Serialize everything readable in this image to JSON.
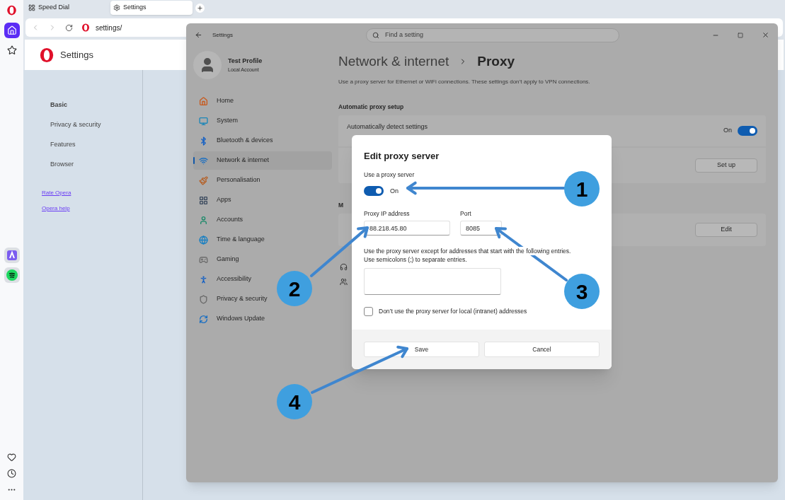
{
  "browser_sidebar": {
    "top": [
      {
        "kind": "home",
        "selected": true
      },
      {
        "kind": "star",
        "selected": false
      }
    ],
    "apps": [
      {
        "kind": "aria",
        "selected": false
      },
      {
        "kind": "spotify",
        "selected": false
      }
    ],
    "bottom": [
      {
        "kind": "heart",
        "selected": false
      },
      {
        "kind": "clock",
        "selected": false
      },
      {
        "kind": "more",
        "selected": false
      }
    ]
  },
  "tabs": [
    {
      "label": "Speed Dial",
      "kind": "speed-dial",
      "selected": false
    },
    {
      "label": "Settings",
      "kind": "settings",
      "selected": true
    }
  ],
  "address_bar": {
    "url": "settings/"
  },
  "settings_page": {
    "title": "Settings",
    "nav": [
      {
        "label": "Basic",
        "selected": true
      },
      {
        "label": "Privacy & security",
        "selected": false
      },
      {
        "label": "Features",
        "selected": false
      },
      {
        "label": "Browser",
        "selected": false
      }
    ],
    "links": [
      "Rate Opera",
      "Opera help"
    ]
  },
  "windows_settings": {
    "title": "Settings",
    "search": {
      "placeholder": "Find a setting"
    },
    "profile": {
      "name": "Test Profile",
      "account": "Local Account"
    },
    "nav": [
      {
        "label": "Home",
        "kind": "home",
        "selected": false
      },
      {
        "label": "System",
        "kind": "system",
        "selected": false
      },
      {
        "label": "Bluetooth & devices",
        "kind": "bluetooth",
        "selected": false
      },
      {
        "label": "Network & internet",
        "kind": "network",
        "selected": true
      },
      {
        "label": "Personalisation",
        "kind": "brush",
        "selected": false
      },
      {
        "label": "Apps",
        "kind": "apps",
        "selected": false
      },
      {
        "label": "Accounts",
        "kind": "accounts",
        "selected": false
      },
      {
        "label": "Time & language",
        "kind": "time",
        "selected": false
      },
      {
        "label": "Gaming",
        "kind": "gaming",
        "selected": false
      },
      {
        "label": "Accessibility",
        "kind": "accessibility",
        "selected": false
      },
      {
        "label": "Privacy & security",
        "kind": "privacy",
        "selected": false
      },
      {
        "label": "Windows Update",
        "kind": "update",
        "selected": false
      }
    ],
    "breadcrumb": {
      "parent": "Network & internet",
      "current": "Proxy"
    },
    "description": "Use a proxy server for Ethernet or WiFi connections. These settings don’t apply to VPN connections.",
    "automatic_section": {
      "heading": "Automatic proxy setup",
      "detect": {
        "label": "Automatically detect settings",
        "state": "On",
        "on": true
      },
      "setup_button": "Set up"
    },
    "manual_section": {
      "heading": "M",
      "edit_button": "Edit"
    }
  },
  "dialog": {
    "title": "Edit proxy server",
    "use_proxy": {
      "label": "Use a proxy server",
      "state": "On",
      "on": true
    },
    "ip": {
      "label": "Proxy IP address",
      "value": "88.218.45.80"
    },
    "port": {
      "label": "Port",
      "value": "8085"
    },
    "exceptions": {
      "note": [
        "Use the proxy server except for addresses that start with the following entries.",
        "Use semicolons (;) to separate entries."
      ]
    },
    "local": {
      "label": "Don’t use the proxy server for local (intranet) addresses",
      "checked": false
    },
    "buttons": [
      "Save",
      "Cancel"
    ]
  },
  "annotations": [
    {
      "label": "1"
    },
    {
      "label": "2"
    },
    {
      "label": "3"
    },
    {
      "label": "4"
    }
  ]
}
